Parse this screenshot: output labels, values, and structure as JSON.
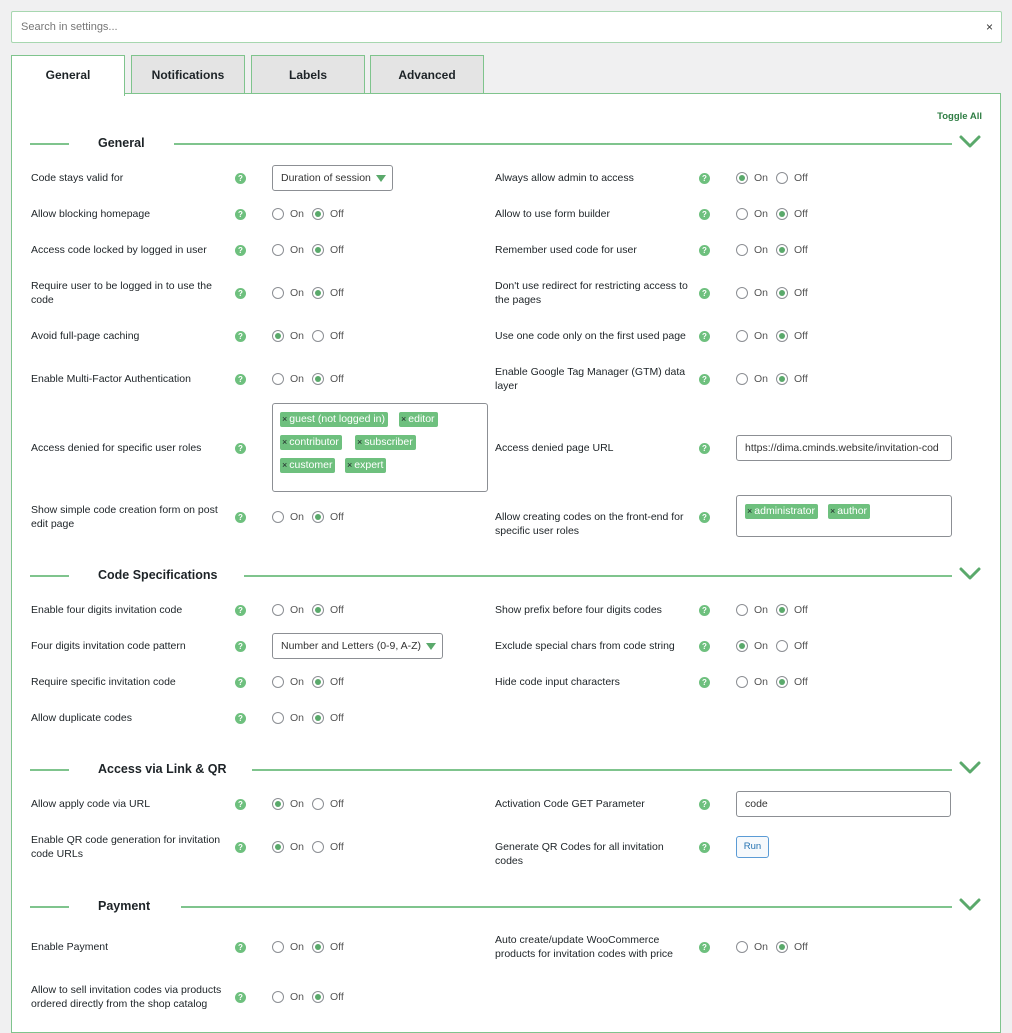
{
  "search": {
    "placeholder": "Search in settings...",
    "clear_icon": "×"
  },
  "tabs": [
    {
      "label": "General",
      "active": true
    },
    {
      "label": "Notifications",
      "active": false
    },
    {
      "label": "Labels",
      "active": false
    },
    {
      "label": "Advanced",
      "active": false
    }
  ],
  "toggle_all": "Toggle All",
  "radio_labels": {
    "on": "On",
    "off": "Off"
  },
  "help_glyph": "?",
  "colors": {
    "accent": "#6ec07e",
    "border": "#7fc48d",
    "link": "#2e7d43",
    "button": "#2271b1"
  },
  "sections": {
    "general": {
      "title": "General",
      "code_valid": {
        "label": "Code stays valid for",
        "value": "Duration of session"
      },
      "admin_access": {
        "label": "Always allow admin to access",
        "value": "On"
      },
      "block_homepage": {
        "label": "Allow blocking homepage",
        "value": "Off"
      },
      "form_builder": {
        "label": "Allow to use form builder",
        "value": "Off"
      },
      "locked_logged": {
        "label": "Access code locked by logged in user",
        "value": "Off"
      },
      "remember_code": {
        "label": "Remember used code for user",
        "value": "Off"
      },
      "require_logged": {
        "label": "Require user to be logged in to use the code",
        "value": "Off"
      },
      "no_redirect": {
        "label": "Don't use redirect for restricting access to the pages",
        "value": "Off"
      },
      "avoid_caching": {
        "label": "Avoid full-page caching",
        "value": "On"
      },
      "one_code_first": {
        "label": "Use one code only on the first used page",
        "value": "Off"
      },
      "mfa": {
        "label": "Enable Multi-Factor Authentication",
        "value": "Off"
      },
      "gtm": {
        "label": "Enable Google Tag Manager (GTM) data layer",
        "value": "Off"
      },
      "denied_roles": {
        "label": "Access denied for specific user roles",
        "tags": [
          "guest (not logged in)",
          "editor",
          "contributor",
          "subscriber",
          "customer",
          "expert"
        ]
      },
      "denied_url": {
        "label": "Access denied page URL",
        "value": "https://dima.cminds.website/invitation-cod"
      },
      "simple_form": {
        "label": "Show simple code creation form on post edit page",
        "value": "Off"
      },
      "frontend_roles": {
        "label": "Allow creating codes on the front-end for specific user roles",
        "tags": [
          "administrator",
          "author"
        ]
      }
    },
    "code_spec": {
      "title": "Code Specifications",
      "four_digits": {
        "label": "Enable four digits invitation code",
        "value": "Off"
      },
      "show_prefix": {
        "label": "Show prefix before four digits codes",
        "value": "Off"
      },
      "pattern": {
        "label": "Four digits invitation code pattern",
        "value": "Number and Letters (0-9, A-Z)"
      },
      "exclude_special": {
        "label": "Exclude special chars from code string",
        "value": "On"
      },
      "require_specific": {
        "label": "Require specific invitation code",
        "value": "Off"
      },
      "hide_input": {
        "label": "Hide code input characters",
        "value": "Off"
      },
      "duplicate": {
        "label": "Allow duplicate codes",
        "value": "Off"
      }
    },
    "access_link": {
      "title": "Access via Link & QR",
      "via_url": {
        "label": "Allow apply code via URL",
        "value": "On"
      },
      "get_param": {
        "label": "Activation Code GET Parameter",
        "value": "code"
      },
      "qr_enable": {
        "label": "Enable QR code generation for invitation code URLs",
        "value": "On"
      },
      "qr_generate": {
        "label": "Generate QR Codes for all invitation codes",
        "button": "Run"
      }
    },
    "payment": {
      "title": "Payment",
      "enable": {
        "label": "Enable Payment",
        "value": "Off"
      },
      "woo_auto": {
        "label": "Auto create/update WooCommerce products for invitation codes with price",
        "value": "Off"
      },
      "sell_catalog": {
        "label": "Allow to sell invitation codes via products ordered directly from the shop catalog",
        "value": "Off"
      }
    }
  }
}
